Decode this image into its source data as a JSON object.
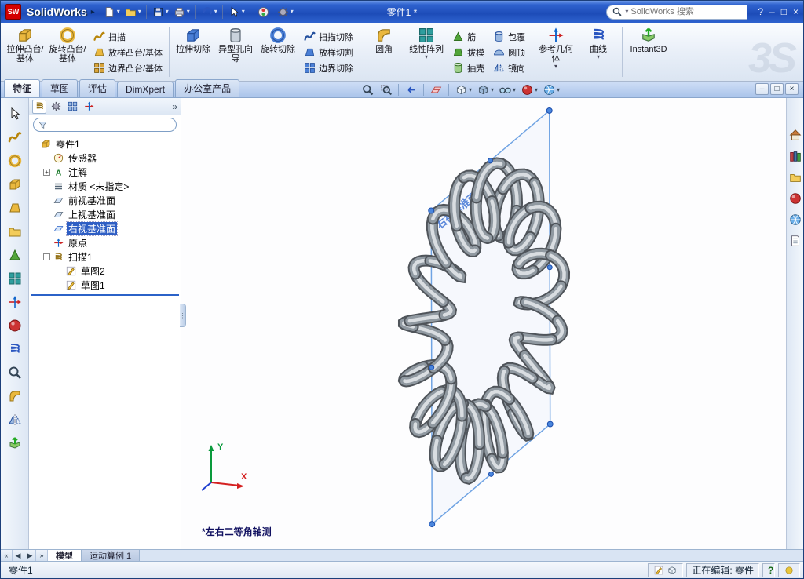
{
  "titlebar": {
    "app_name": "SolidWorks",
    "doc_title": "零件1 *",
    "search_placeholder": "SolidWorks 搜索",
    "window_controls": {
      "help": "?",
      "min": "–",
      "max": "□",
      "close": "×"
    }
  },
  "ui": {
    "caret": "▾",
    "flyout": "▸",
    "overflow": "»",
    "grip": "⋮"
  },
  "ribbon": {
    "watermark": "3S",
    "items": [
      {
        "label": "拉伸凸台/基体"
      },
      {
        "label": "旋转凸台/基体"
      },
      {
        "label": "扫描"
      },
      {
        "label": "放样凸台/基体"
      },
      {
        "label": "边界凸台/基体"
      },
      {
        "label": "拉伸切除"
      },
      {
        "label": "异型孔向导"
      },
      {
        "label": "旋转切除"
      },
      {
        "label": "扫描切除"
      },
      {
        "label": "放样切割"
      },
      {
        "label": "边界切除"
      },
      {
        "label": "圆角"
      },
      {
        "label": "线性阵列"
      },
      {
        "label": "筋"
      },
      {
        "label": "拔模"
      },
      {
        "label": "抽壳"
      },
      {
        "label": "包覆"
      },
      {
        "label": "圆顶"
      },
      {
        "label": "镜向"
      },
      {
        "label": "参考几何体"
      },
      {
        "label": "曲线"
      },
      {
        "label": "Instant3D"
      }
    ]
  },
  "tabs": {
    "items": [
      {
        "label": "特征"
      },
      {
        "label": "草图"
      },
      {
        "label": "评估"
      },
      {
        "label": "DimXpert"
      },
      {
        "label": "办公室产品"
      }
    ],
    "active": "特征"
  },
  "tree": {
    "expanders": {
      "plus": "+",
      "minus": "−"
    },
    "items": [
      {
        "label": "零件1"
      },
      {
        "label": "传感器"
      },
      {
        "label": "注解"
      },
      {
        "label": "材质 <未指定>"
      },
      {
        "label": "前视基准面"
      },
      {
        "label": "上视基准面"
      },
      {
        "label": "右视基准面",
        "selected": true
      },
      {
        "label": "原点"
      },
      {
        "label": "扫描1"
      },
      {
        "label": "草图2"
      },
      {
        "label": "草图1"
      }
    ]
  },
  "viewport": {
    "plane_label": "右视基准面",
    "view_orientation_label": "*左右二等角轴测",
    "triad": {
      "x": "X",
      "y": "Y"
    }
  },
  "bottom_tabs": {
    "nav": {
      "first": "«",
      "prev": "◀",
      "next": "▶",
      "last": "»"
    },
    "model": "模型",
    "motion": "运动算例 1"
  },
  "statusbar": {
    "left": "零件1",
    "editing": "正在编辑: 零件",
    "help": "?"
  }
}
